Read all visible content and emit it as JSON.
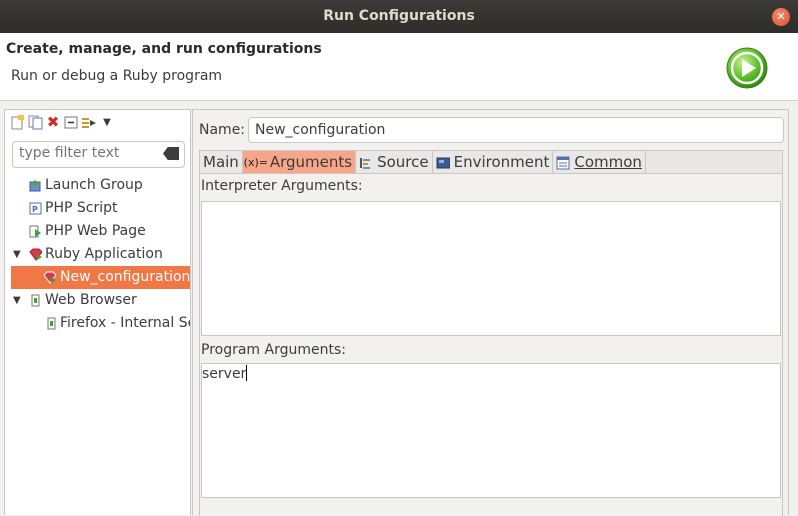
{
  "window": {
    "title": "Run Configurations"
  },
  "header": {
    "title": "Create, manage, and run configurations",
    "subtitle": "Run or debug a Ruby program"
  },
  "sidebar": {
    "filter_placeholder": "type filter text",
    "items": [
      {
        "label": "Launch Group",
        "icon": "launch-group-icon",
        "level": 1
      },
      {
        "label": "PHP Script",
        "icon": "php-script-icon",
        "level": 1
      },
      {
        "label": "PHP Web Page",
        "icon": "php-web-page-icon",
        "level": 1
      },
      {
        "label": "Ruby Application",
        "icon": "ruby-application-icon",
        "level": 1,
        "expanded": true
      },
      {
        "label": "New_configuration",
        "icon": "ruby-config-icon",
        "level": 2,
        "selected": true
      },
      {
        "label": "Web Browser",
        "icon": "web-browser-icon",
        "level": 1,
        "expanded": true
      },
      {
        "label": "Firefox - Internal Se",
        "icon": "browser-config-icon",
        "level": 2
      }
    ]
  },
  "main": {
    "name_label": "Name:",
    "name_value": "New_configuration",
    "tabs": [
      {
        "label": "Main",
        "icon": ""
      },
      {
        "label": "Arguments",
        "icon": "arguments-icon",
        "active": true
      },
      {
        "label": "Source",
        "icon": "source-icon"
      },
      {
        "label": "Environment",
        "icon": "environment-icon"
      },
      {
        "label": "Common",
        "icon": "common-icon"
      }
    ],
    "interpreter_label": "Interpreter Arguments:",
    "interpreter_value": "",
    "program_label": "Program Arguments:",
    "program_value": "server"
  },
  "colors": {
    "selection": "#f07746",
    "active_tab": "#f7a68a",
    "titlebar": "#3c3b37"
  }
}
